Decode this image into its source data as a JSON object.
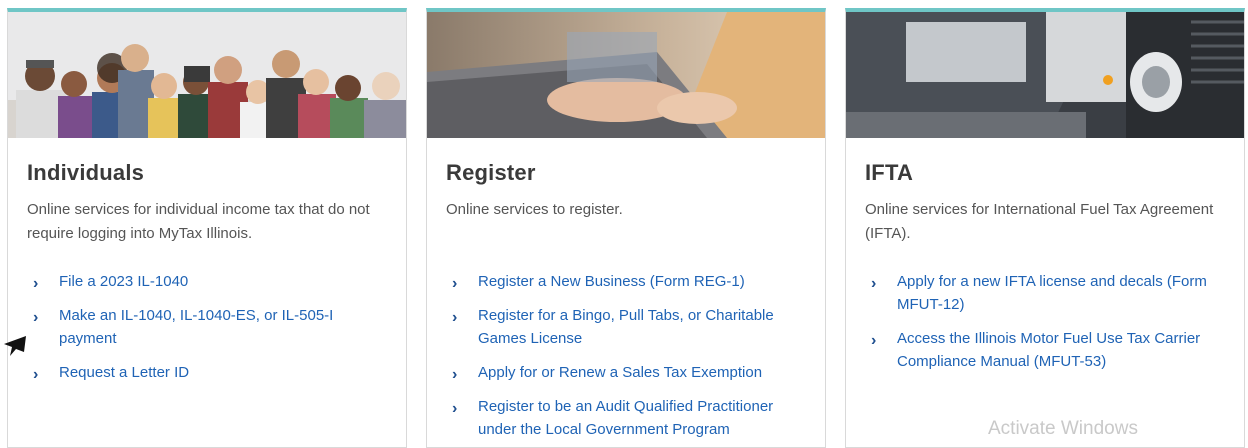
{
  "cards": [
    {
      "title": "Individuals",
      "description": "Online services for individual income tax that do not require logging into MyTax Illinois.",
      "links": [
        "File a 2023 IL-1040",
        "Make an IL-1040, IL-1040-ES, or IL-505-I payment",
        "Request a Letter ID"
      ]
    },
    {
      "title": "Register",
      "description": "Online services to register.",
      "links": [
        "Register a New Business (Form REG-1)",
        "Register for a Bingo, Pull Tabs, or Charitable Games License",
        "Apply for or Renew a Sales Tax Exemption",
        "Register to be an Audit Qualified Practitioner under the Local Government Program"
      ]
    },
    {
      "title": "IFTA",
      "description": "Online services for International Fuel Tax Agreement (IFTA).",
      "links": [
        "Apply for a new IFTA license and decals (Form MFUT-12)",
        "Access the Illinois Motor Fuel Use Tax Carrier Compliance Manual (MFUT-53)"
      ]
    }
  ],
  "icons": {
    "link_chevron": "chevron-right-icon",
    "cursor": "mouse-pointer-icon"
  },
  "watermark": "Activate Windows",
  "colors": {
    "accent_border": "#6fc6c6",
    "link": "#1f63b5",
    "title": "#3a3a3a",
    "text": "#555555"
  }
}
